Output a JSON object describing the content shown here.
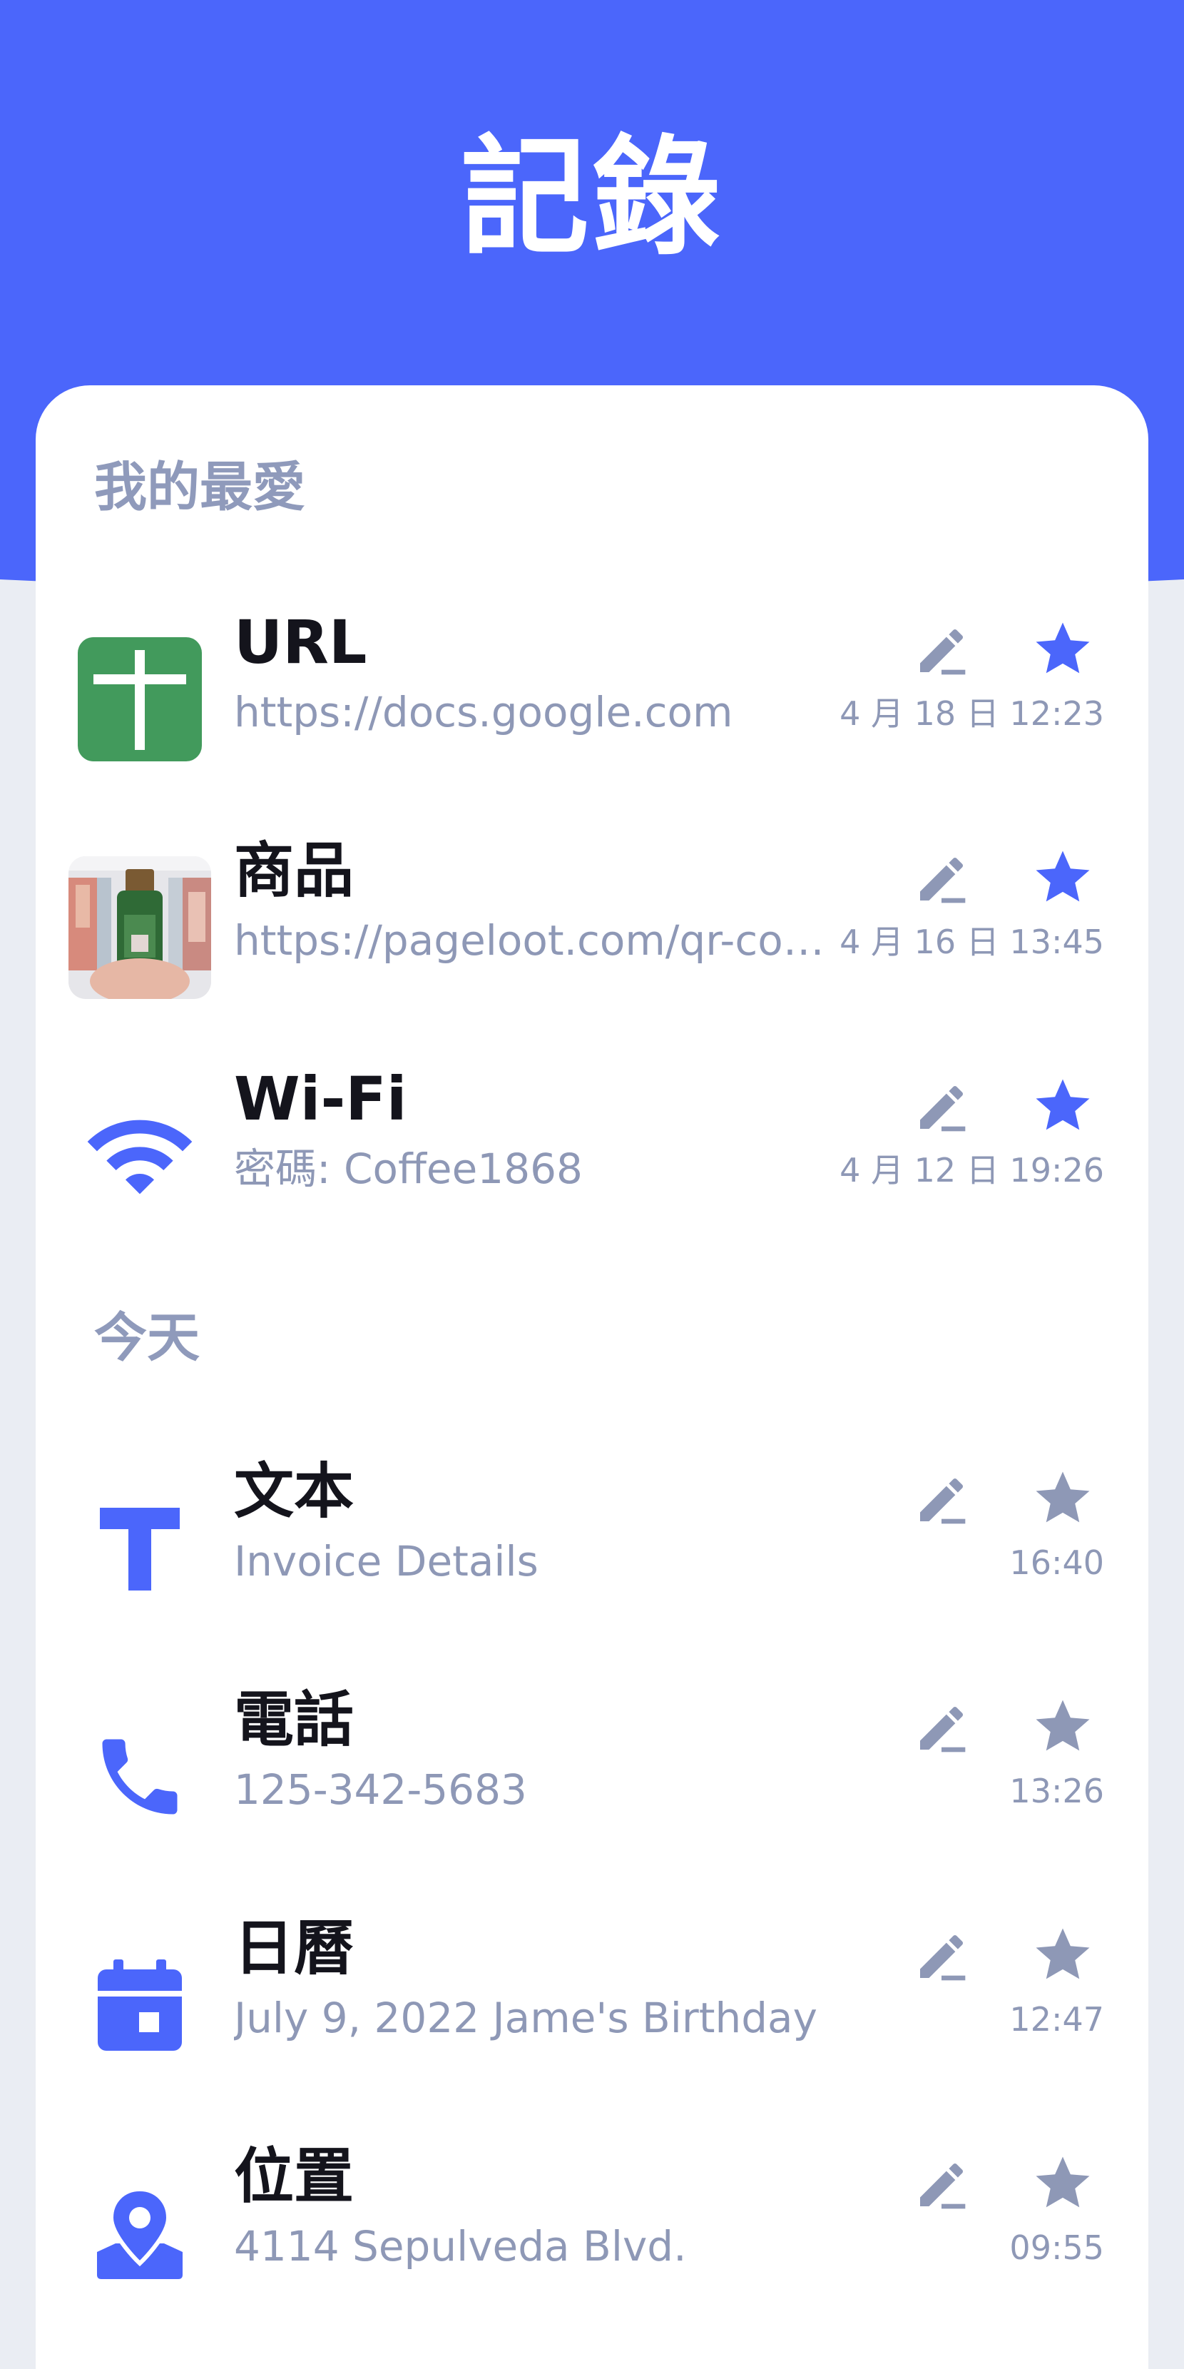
{
  "header": {
    "title": "記錄",
    "background_color": "#4b66fb"
  },
  "colors": {
    "accent": "#4b66fb",
    "star_active": "#4b66fb",
    "star_inactive": "#8e98b6",
    "edit_icon": "#8e98b6",
    "secondary_text": "#8e98b6",
    "primary_text": "#14141c"
  },
  "favorites": {
    "title": "我的最愛",
    "items": [
      {
        "type_label": "URL",
        "content": "https://docs.google.com",
        "time": "4 月 18 日 12:23",
        "icon": "google-docs-icon",
        "favorited": true
      },
      {
        "type_label": "商品",
        "content": "https://pageloot.com/qr-code-generator",
        "time": "4 月 16 日 13:45",
        "icon": "product-photo",
        "favorited": true
      },
      {
        "type_label": "Wi-Fi",
        "content": "密碼: Coffee1868",
        "time": "4 月 12 日 19:26",
        "icon": "wifi-icon",
        "favorited": true
      }
    ]
  },
  "today": {
    "title": "今天",
    "items": [
      {
        "type_label": "文本",
        "content": " Invoice Details",
        "time": "16:40",
        "icon": "text-icon",
        "favorited": false
      },
      {
        "type_label": "電話",
        "content": "125-342-5683",
        "time": "13:26",
        "icon": "phone-icon",
        "favorited": false
      },
      {
        "type_label": "日曆",
        "content": "July 9, 2022 Jame's Birthday",
        "time": "12:47",
        "icon": "calendar-icon",
        "favorited": false
      },
      {
        "type_label": "位置",
        "content": "4114 Sepulveda Blvd.",
        "time": "09:55",
        "icon": "location-icon",
        "favorited": false
      }
    ]
  }
}
